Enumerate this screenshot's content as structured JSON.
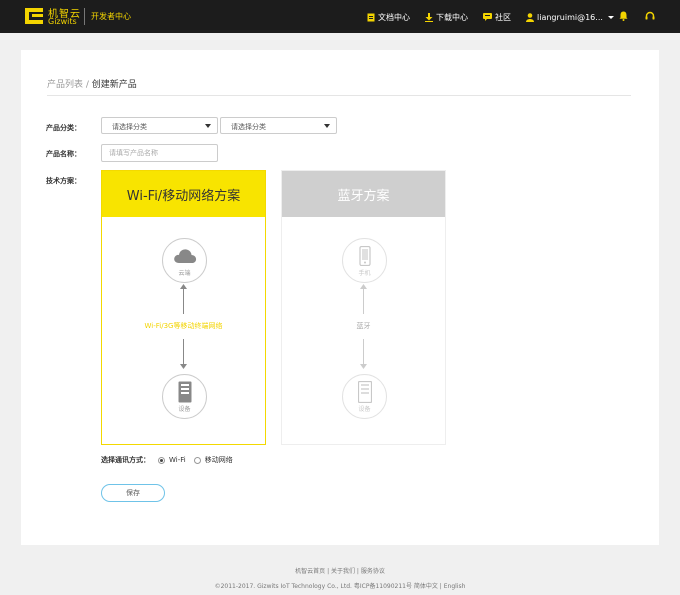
{
  "header": {
    "logo_cn": "机智云",
    "logo_en": "Gizwits",
    "dev_center": "开发者中心",
    "nav": [
      {
        "label": "文档中心",
        "icon": "document-icon"
      },
      {
        "label": "下载中心",
        "icon": "download-icon"
      },
      {
        "label": "社区",
        "icon": "chat-icon"
      }
    ],
    "user": "liangruimi@16...",
    "icons": [
      "user-icon",
      "bell-icon",
      "headset-icon"
    ],
    "accent_color": "#f3d400"
  },
  "breadcrumb": {
    "parent": "产品列表",
    "separator": " / ",
    "current": "创建新产品"
  },
  "form": {
    "category_label": "产品分类：",
    "category_select_1": "请选择分类",
    "category_select_2": "请选择分类",
    "name_label": "产品名称：",
    "name_placeholder": "请填写产品名称",
    "tech_label": "技术方案："
  },
  "solutions": {
    "wifi": {
      "title": "Wi-Fi/移动网络方案",
      "top_node": "云端",
      "link": "Wi-Fi/3G等移动终端网络",
      "bottom_node": "设备",
      "selected": true,
      "color": "#f8e400"
    },
    "bluetooth": {
      "title": "蓝牙方案",
      "top_node": "手机",
      "link": "蓝牙",
      "bottom_node": "设备",
      "selected": false,
      "color": "#cfcfcf"
    }
  },
  "comm": {
    "label": "选择通讯方式：",
    "options": [
      {
        "label": "Wi-Fi",
        "checked": true
      },
      {
        "label": "移动网络",
        "checked": false
      }
    ]
  },
  "save_label": "保存",
  "footer": {
    "links": "机智云首页 | 关于我们 | 服务协议",
    "copyright": "©2011-2017. Gizwits IoT Technology Co., Ltd. 粤ICP备11090211号 简体中文 | English"
  }
}
